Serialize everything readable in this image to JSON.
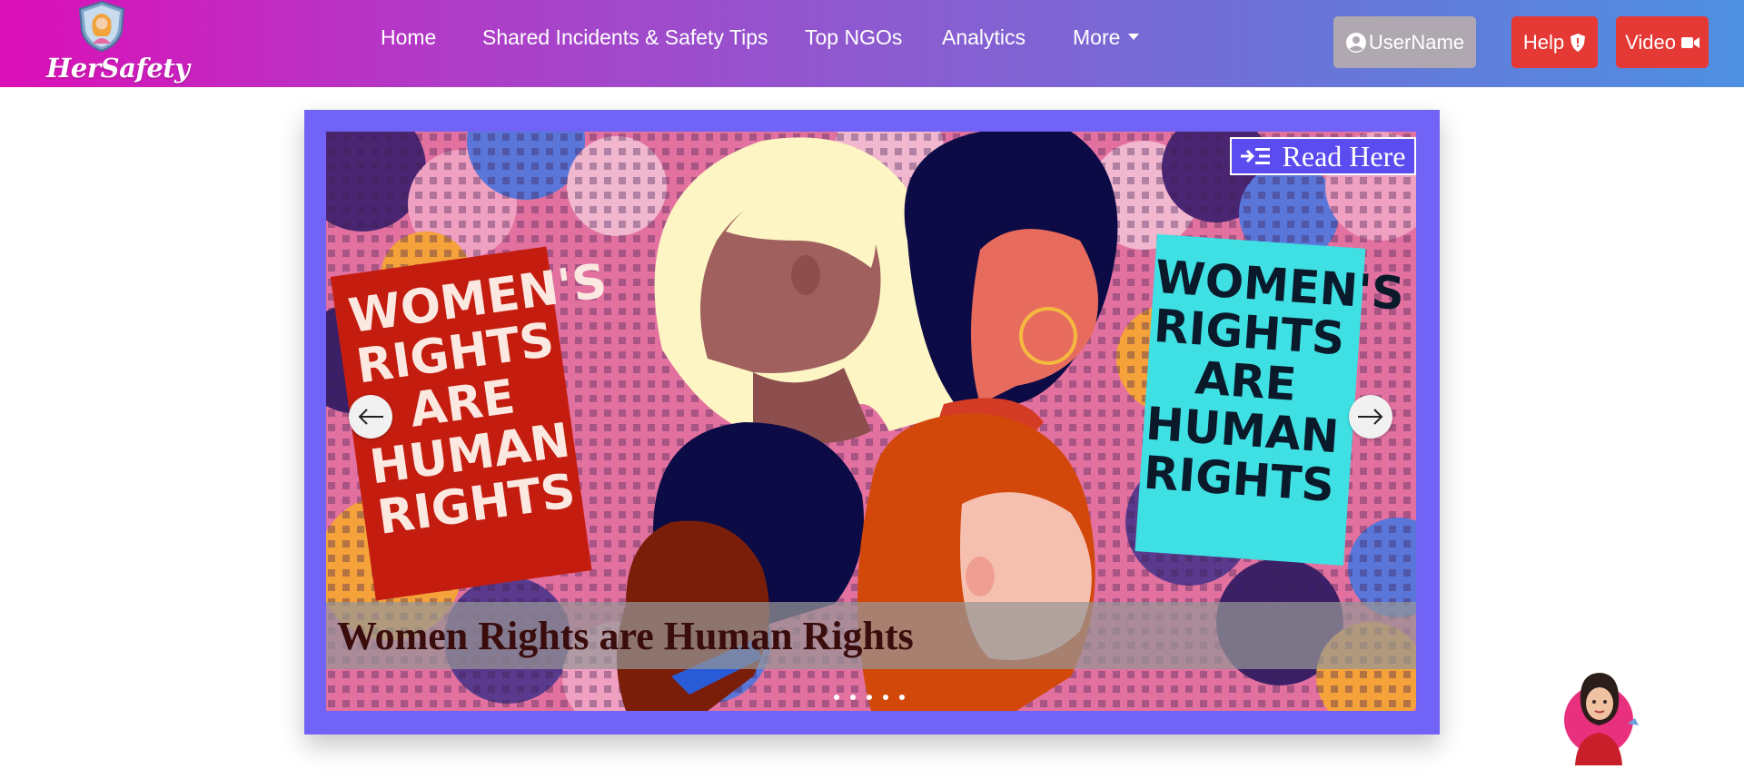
{
  "brand": {
    "logo_text": "HerSafety"
  },
  "nav": {
    "items": [
      {
        "label": "Home"
      },
      {
        "label": "Shared Incidents & Safety Tips"
      },
      {
        "label": "Top NGOs"
      },
      {
        "label": "Analytics"
      },
      {
        "label": "More"
      }
    ]
  },
  "header_buttons": {
    "username": "UserName",
    "help": "Help",
    "video": "Video"
  },
  "carousel": {
    "read_here_label": "Read Here",
    "caption": "Women Rights are Human Rights",
    "indicator_count": 5,
    "banner_left": [
      "WOMEN'S",
      "RIGHTS",
      "ARE",
      "HUMAN",
      "RIGHTS"
    ],
    "banner_right": [
      "WOMEN'S",
      "RIGHTS",
      "ARE",
      "HUMAN",
      "RIGHTS"
    ]
  },
  "colors": {
    "nav_gradient_start": "#dc0fb7",
    "nav_gradient_end": "#4e90e0",
    "carousel_frame": "#7163f5",
    "danger": "#e53935",
    "user_button": "#b0a8b0"
  },
  "icons": [
    "user-circle-icon",
    "shield-icon",
    "video-camera-icon",
    "indent-icon",
    "arrow-left-icon",
    "arrow-right-icon"
  ]
}
